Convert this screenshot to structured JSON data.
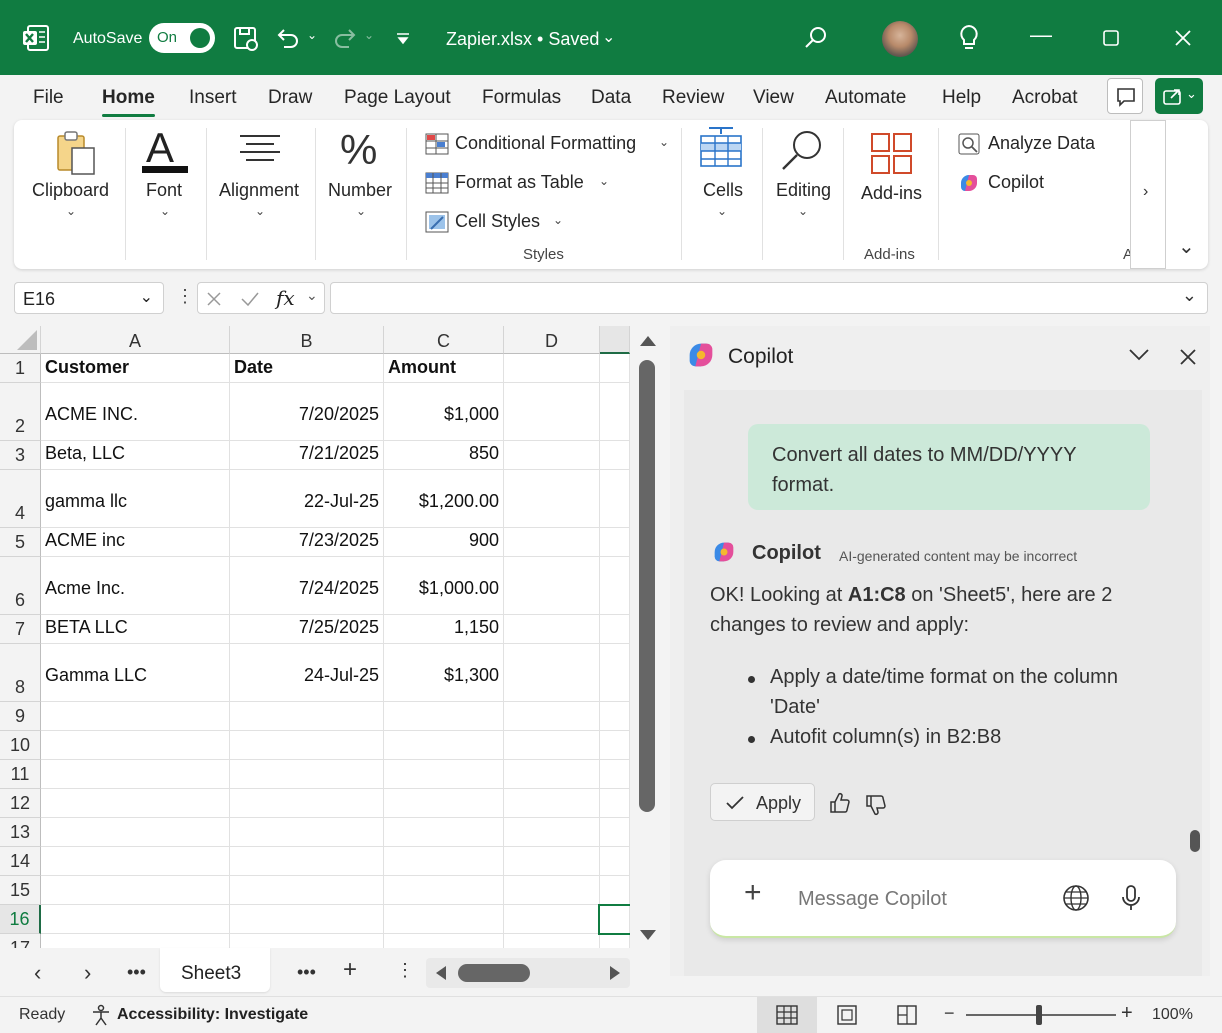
{
  "titlebar": {
    "autosave_label": "AutoSave",
    "autosave_state": "On",
    "file_title": "Zapier.xlsx • Saved"
  },
  "menu": {
    "tabs": [
      "File",
      "Home",
      "Insert",
      "Draw",
      "Page Layout",
      "Formulas",
      "Data",
      "Review",
      "View",
      "Automate",
      "Help",
      "Acrobat"
    ],
    "active": "Home"
  },
  "ribbon": {
    "clipboard": "Clipboard",
    "font": "Font",
    "alignment": "Alignment",
    "number": "Number",
    "conditional": "Conditional Formatting",
    "format_table": "Format as Table",
    "cell_styles": "Cell Styles",
    "styles_group": "Styles",
    "cells": "Cells",
    "editing": "Editing",
    "addins": "Add-ins",
    "addins_group": "Add-ins",
    "analyze": "Analyze Data",
    "copilot": "Copilot",
    "cut_group": "A"
  },
  "formula": {
    "namebox": "E16",
    "fx": "fx",
    "value": ""
  },
  "grid": {
    "columns": [
      "A",
      "B",
      "C",
      "D"
    ],
    "rows": [
      {
        "n": "1",
        "a": "Customer",
        "b": "Date",
        "c": "Amount"
      },
      {
        "n": "2",
        "a": "ACME INC.",
        "b": "7/20/2025",
        "c": "$1,000"
      },
      {
        "n": "3",
        "a": "Beta, LLC",
        "b": "7/21/2025",
        "c": "850"
      },
      {
        "n": "4",
        "a": "gamma llc",
        "b": "22-Jul-25",
        "c": "$1,200.00"
      },
      {
        "n": "5",
        "a": "ACME inc",
        "b": "7/23/2025",
        "c": "900"
      },
      {
        "n": "6",
        "a": "Acme Inc.",
        "b": "7/24/2025",
        "c": "$1,000.00"
      },
      {
        "n": "7",
        "a": "BETA LLC",
        "b": "7/25/2025",
        "c": "1,150"
      },
      {
        "n": "8",
        "a": "Gamma LLC",
        "b": "24-Jul-25",
        "c": "$1,300"
      },
      {
        "n": "9",
        "a": "",
        "b": "",
        "c": ""
      },
      {
        "n": "10",
        "a": "",
        "b": "",
        "c": ""
      },
      {
        "n": "11",
        "a": "",
        "b": "",
        "c": ""
      },
      {
        "n": "12",
        "a": "",
        "b": "",
        "c": ""
      },
      {
        "n": "13",
        "a": "",
        "b": "",
        "c": ""
      },
      {
        "n": "14",
        "a": "",
        "b": "",
        "c": ""
      },
      {
        "n": "15",
        "a": "",
        "b": "",
        "c": ""
      },
      {
        "n": "16",
        "a": "",
        "b": "",
        "c": ""
      },
      {
        "n": "17",
        "a": "",
        "b": "",
        "c": ""
      }
    ]
  },
  "sheets": {
    "active": "Sheet3"
  },
  "status": {
    "ready": "Ready",
    "accessibility": "Accessibility: Investigate",
    "zoom": "100%"
  },
  "copilot": {
    "title": "Copilot",
    "user_message": "Convert all dates to MM/DD/YYYY format.",
    "sender": "Copilot",
    "disclaimer": "AI-generated content may be incorrect",
    "reply_prefix": "OK! Looking at ",
    "reply_range": "A1:C8",
    "reply_mid": " on 'Sheet5', here are 2",
    "reply_line2": "changes to review and apply:",
    "bullet1_line1": "Apply a date/time format on the column",
    "bullet1_line2": "'Date'",
    "bullet2": "Autofit column(s) in B2:B8",
    "apply_label": "Apply",
    "placeholder": "Message Copilot"
  }
}
